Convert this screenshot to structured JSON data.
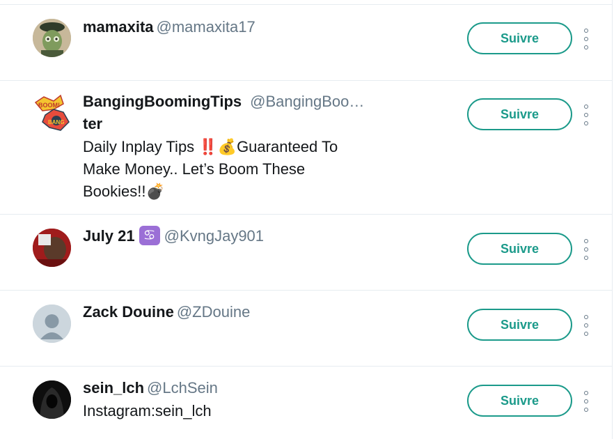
{
  "follow_label": "Suivre",
  "accent_color": "#1b9a8a",
  "users": [
    {
      "name": "mamaxita",
      "handle": "@mamaxita17",
      "bio_lines": [],
      "avatar": "cartoon-avatar"
    },
    {
      "name": "BangingBoomingTips",
      "handle": "@BangingBoo…",
      "name_wrap": "ter",
      "bio_lines": [
        "Daily Inplay Tips ‼️💰Guaranteed To",
        "Make Money.. Let’s Boom These",
        "Bookies!!💣"
      ],
      "avatar": "comic-boom-logo"
    },
    {
      "name": "July 21",
      "zodiac": "♋",
      "handle": "@KvngJay901",
      "bio_lines": [],
      "avatar": "photo-avatar"
    },
    {
      "name": "Zack Douine",
      "handle": "@ZDouine",
      "bio_lines": [],
      "avatar": "default-avatar"
    },
    {
      "name": "sein_lch",
      "handle": "@LchSein",
      "bio_lines": [
        "Instagram:sein_lch"
      ],
      "avatar": "hooded-figure-avatar"
    }
  ]
}
